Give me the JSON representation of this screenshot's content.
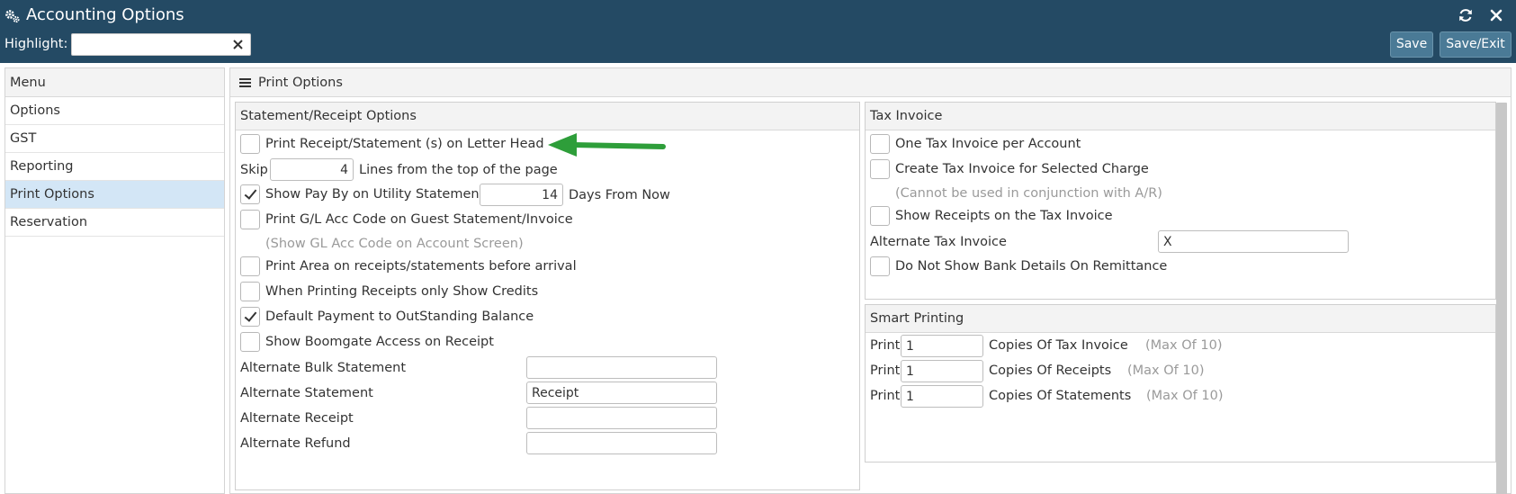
{
  "app": {
    "title": "Accounting Options",
    "title_icon": "gears-icon",
    "highlight_label": "Highlight:",
    "highlight_value": "",
    "save_label": "Save",
    "save_exit_label": "Save/Exit"
  },
  "menu": {
    "header": "Menu",
    "items": [
      {
        "label": "Options"
      },
      {
        "label": "GST"
      },
      {
        "label": "Reporting"
      },
      {
        "label": "Print Options",
        "active": true
      },
      {
        "label": "Reservation"
      }
    ]
  },
  "main": {
    "title": "Print Options"
  },
  "statement": {
    "header": "Statement/Receipt Options",
    "letterhead_label": "Print Receipt/Statement (s) on Letter Head",
    "letterhead_checked": false,
    "skip_label": "Skip",
    "skip_value": "4",
    "skip_suffix": "Lines from the top of the page",
    "payby_label": "Show Pay By on Utility Statement",
    "payby_checked": true,
    "payby_days": "14",
    "payby_suffix": "Days From Now",
    "glcode_label": "Print G/L Acc Code on Guest Statement/Invoice",
    "glcode_checked": false,
    "glcode_hint": "(Show GL Acc Code on Account Screen)",
    "area_label": "Print Area on receipts/statements before arrival",
    "area_checked": false,
    "credits_label": "When Printing Receipts only Show Credits",
    "credits_checked": false,
    "default_payment_label": "Default Payment to OutStanding Balance",
    "default_payment_checked": true,
    "boomgate_label": "Show Boomgate Access on Receipt",
    "boomgate_checked": false,
    "alt_bulk_label": "Alternate Bulk Statement",
    "alt_bulk_value": "",
    "alt_statement_label": "Alternate Statement",
    "alt_statement_value": "Receipt",
    "alt_receipt_label": "Alternate Receipt",
    "alt_receipt_value": "",
    "alt_refund_label": "Alternate Refund",
    "alt_refund_value": ""
  },
  "tax": {
    "header": "Tax Invoice",
    "one_per_account_label": "One Tax Invoice per Account",
    "one_per_account_checked": false,
    "selected_charge_label": "Create Tax Invoice for Selected Charge",
    "selected_charge_checked": false,
    "selected_charge_hint": "(Cannot be used in conjunction with A/R)",
    "show_receipts_label": "Show Receipts on the Tax Invoice",
    "show_receipts_checked": false,
    "alternate_label": "Alternate Tax Invoice",
    "alternate_value": "X",
    "no_bank_label": "Do Not Show Bank Details On Remittance",
    "no_bank_checked": false
  },
  "smart": {
    "header": "Smart Printing",
    "print_label": "Print",
    "tax_copies": "1",
    "tax_label": "Copies Of Tax Invoice",
    "receipt_copies": "1",
    "receipt_label": "Copies Of Receipts",
    "statement_copies": "1",
    "statement_label": "Copies Of Statements",
    "max_label": "(Max Of 10)"
  },
  "colors": {
    "titlebar": "#244a64",
    "button": "#4a7a96",
    "menu_active": "#d3e6f6",
    "arrow": "#2e9e3a"
  }
}
